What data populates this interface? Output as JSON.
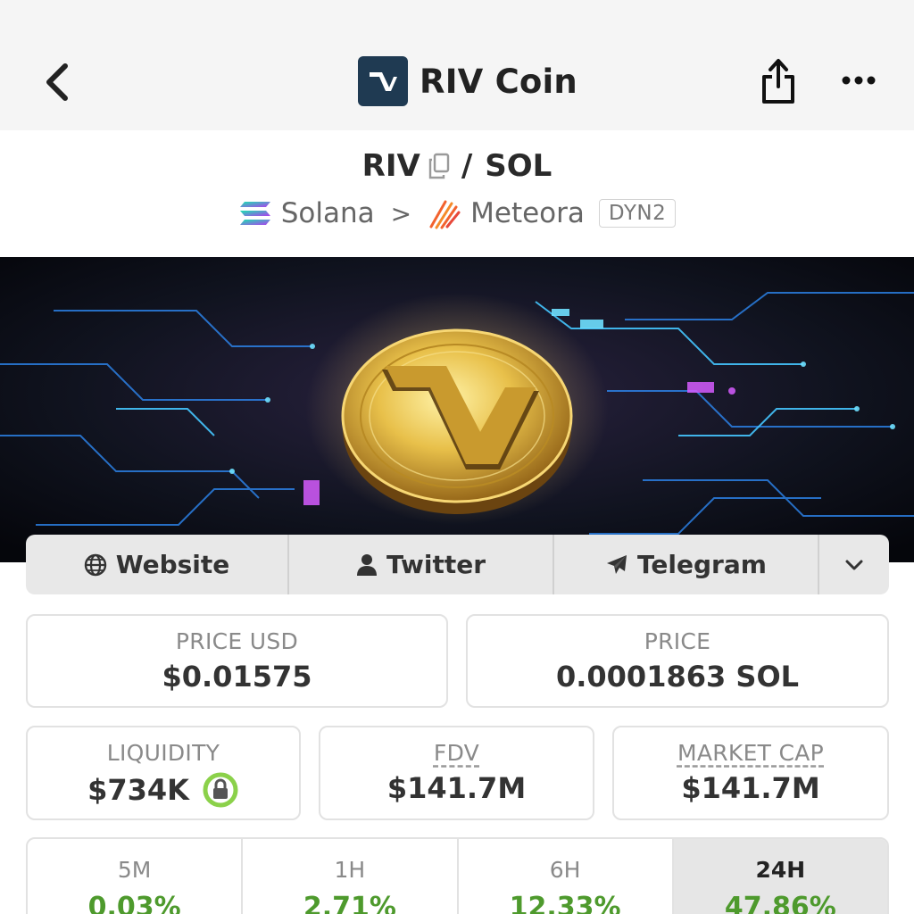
{
  "header": {
    "title": "RIV Coin",
    "logo_color": "#1f3a52",
    "icons": {
      "back": "chevron-left-icon",
      "share": "share-icon",
      "more": "more-horizontal-icon"
    }
  },
  "pair": {
    "base": "RIV",
    "slash": "/",
    "quote": "SOL",
    "chain": "Solana",
    "separator": ">",
    "dex": "Meteora",
    "dex_badge": "DYN2"
  },
  "links": {
    "website": "Website",
    "twitter": "Twitter",
    "telegram": "Telegram"
  },
  "stats": {
    "price_usd": {
      "label": "PRICE USD",
      "value": "$0.01575"
    },
    "price": {
      "label": "PRICE",
      "value": "0.0001863 SOL"
    },
    "liquidity": {
      "label": "LIQUIDITY",
      "value": "$734K"
    },
    "fdv": {
      "label": "FDV",
      "value": "$141.7M"
    },
    "market_cap": {
      "label": "MARKET CAP",
      "value": "$141.7M"
    }
  },
  "timeframes": [
    {
      "label": "5M",
      "value": "0.03%"
    },
    {
      "label": "1H",
      "value": "2.71%"
    },
    {
      "label": "6H",
      "value": "12.33%"
    },
    {
      "label": "24H",
      "value": "47.86%",
      "active": true
    }
  ],
  "colors": {
    "positive": "#4e9a2d",
    "lock_ring": "#8bd14a",
    "active_tab": "#e6e6e6"
  }
}
